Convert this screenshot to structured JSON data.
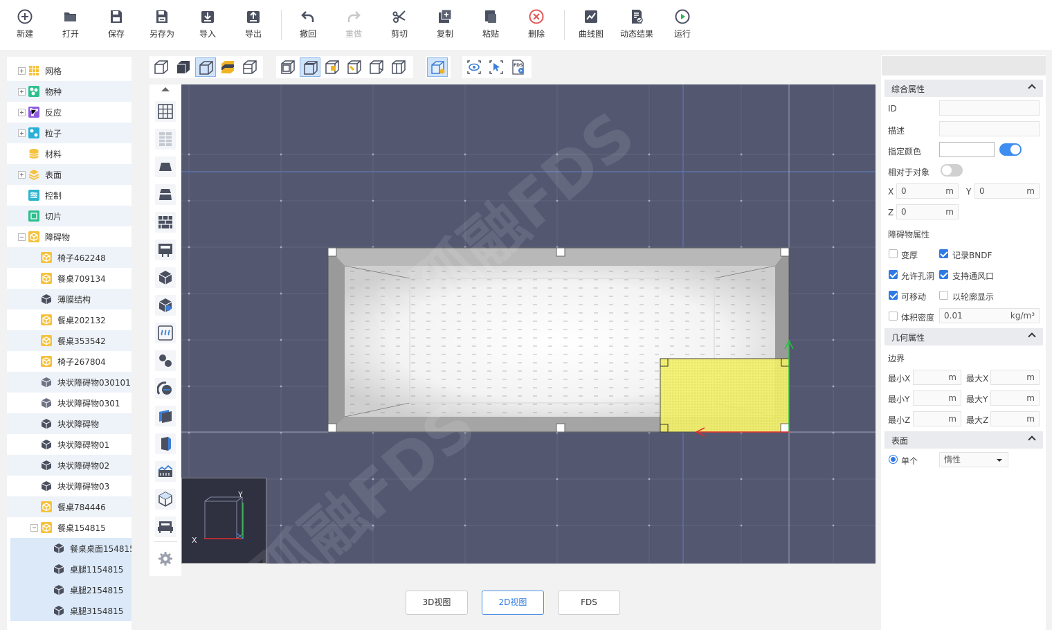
{
  "toolbar": {
    "new": "新建",
    "open": "打开",
    "save": "保存",
    "save_as": "另存为",
    "import": "导入",
    "export": "导出",
    "undo": "撤回",
    "redo": "重做",
    "cut": "剪切",
    "copy": "复制",
    "paste": "粘贴",
    "delete": "删除",
    "curve": "曲线图",
    "dynamic": "动态结果",
    "run": "运行"
  },
  "tree": {
    "items": [
      "网格",
      "物种",
      "反应",
      "粒子",
      "材料",
      "表面",
      "控制",
      "切片",
      "障碍物",
      "椅子462248",
      "餐桌709134",
      "薄膜结构",
      "餐桌202132",
      "餐桌353542",
      "椅子267804",
      "块状障碍物030101",
      "块状障碍物0301",
      "块状障碍物",
      "块状障碍物01",
      "块状障碍物02",
      "块状障碍物03",
      "餐桌784446",
      "餐桌154815",
      "餐桌桌面154815",
      "桌腿1154815",
      "桌腿2154815",
      "桌腿3154815"
    ]
  },
  "viewport": {
    "axis_x": "X",
    "axis_y": "Y",
    "watermark": "小孤融FDS"
  },
  "view_tabs": {
    "tab3d": "3D视图",
    "tab2d": "2D视图",
    "fds": "FDS",
    "fds_icon_text": "FDS"
  },
  "props": {
    "general_title": "综合属性",
    "id_label": "ID",
    "desc_label": "描述",
    "color_label": "指定颜色",
    "relative_label": "相对于对象",
    "x_label": "X",
    "y_label": "Y",
    "z_label": "Z",
    "x_value": "0",
    "y_value": "0",
    "z_value": "0",
    "unit_m": "m",
    "obst_title": "障碍物属性",
    "thicken": "变厚",
    "record_bndf": "记录BNDF",
    "allow_holes": "允许孔洞",
    "support_vent": "支持通风口",
    "movable": "可移动",
    "outline": "以轮廓显示",
    "bulk_density": "体积密度",
    "bulk_density_value": "0.01",
    "bulk_density_unit": "kg/m³",
    "geom_title": "几何属性",
    "bounds": "边界",
    "min_x": "最小X",
    "max_x": "最大X",
    "min_y": "最小Y",
    "max_y": "最大Y",
    "min_z": "最小Z",
    "max_z": "最大Z",
    "surface_title": "表面",
    "single": "单个",
    "surface_value": "惰性"
  },
  "colors": {
    "accent": "#2f7ae5",
    "viewport_bg": "#535770",
    "selection": "#f2f06a"
  }
}
